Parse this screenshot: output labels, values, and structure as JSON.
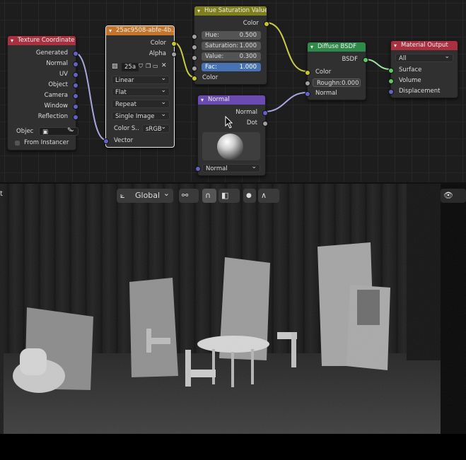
{
  "nodes": {
    "texcoord": {
      "title": "Texture Coordinate",
      "outputs": [
        "Generated",
        "Normal",
        "UV",
        "Object",
        "Camera",
        "Window",
        "Reflection"
      ],
      "object_label": "Objec",
      "from_instancer": "From Instancer"
    },
    "image": {
      "title": "25ac9508-abfe-4b...",
      "outputs": [
        "Color",
        "Alpha"
      ],
      "image_name": "25a",
      "interpolation": "Linear",
      "projection": "Flat",
      "extension": "Repeat",
      "source": "Single Image",
      "colorspace_label": "Color S..",
      "colorspace_value": "sRGB",
      "input": "Vector"
    },
    "hsv": {
      "title": "Hue Saturation Value",
      "output": "Color",
      "hue_label": "Hue:",
      "hue_value": "0.500",
      "sat_label": "Saturation:",
      "sat_value": "1.000",
      "val_label": "Value:",
      "val_value": "0.300",
      "fac_label": "Fac:",
      "fac_value": "1.000",
      "input": "Color"
    },
    "normal": {
      "title": "Normal",
      "outputs": [
        "Normal",
        "Dot"
      ],
      "input": "Normal"
    },
    "diffuse": {
      "title": "Diffuse BSDF",
      "output": "BSDF",
      "color_label": "Color",
      "rough_label": "Roughn:",
      "rough_value": "0.000",
      "normal_label": "Normal"
    },
    "output": {
      "title": "Material Output",
      "target": "All",
      "inputs": [
        "Surface",
        "Volume",
        "Displacement"
      ]
    }
  },
  "viewport": {
    "orientation": "Global",
    "left_edge_text": "t"
  },
  "colors": {
    "texcoord_header": "#a8303f",
    "image_header": "#c4742b",
    "hsv_header": "#7f7f1c",
    "normal_header": "#6b4bb3",
    "diffuse_header": "#2f8a4a",
    "output_header": "#a8303f",
    "fac_accent": "#4772b3"
  },
  "icons": [
    "image-icon",
    "shield-icon",
    "copy-icon",
    "folder-icon",
    "close-icon",
    "eyedropper-icon",
    "transform-orientation-icon",
    "snap-icon",
    "proportional-icon",
    "overlay-icon",
    "shading-icon",
    "visibility-icon"
  ]
}
